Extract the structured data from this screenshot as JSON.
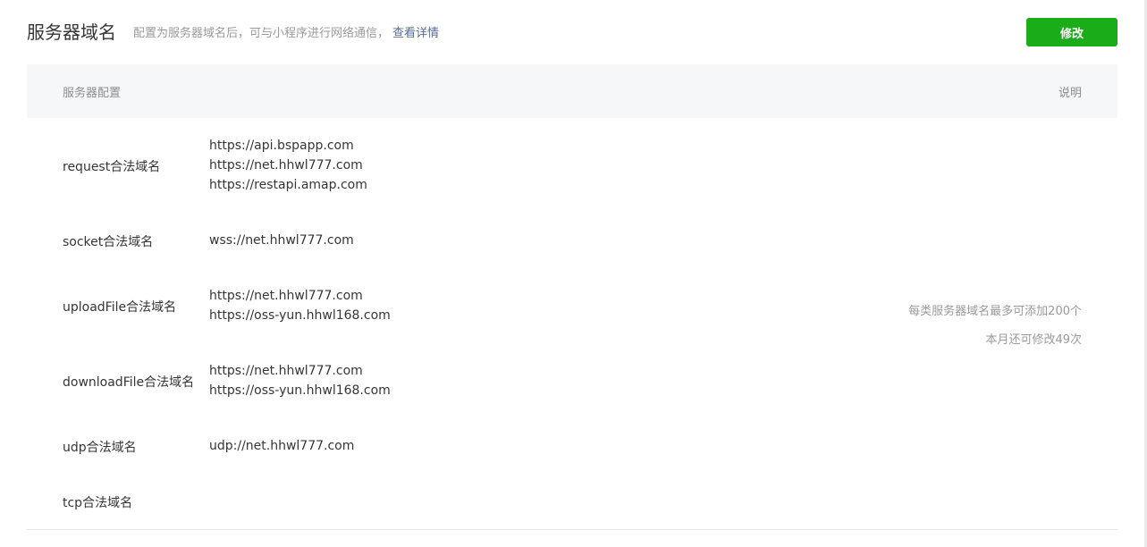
{
  "header": {
    "title": "服务器域名",
    "description": "配置为服务器域名后，可与小程序进行网络通信，",
    "detail_link": "查看详情",
    "edit_button": "修改"
  },
  "table": {
    "col_config": "服务器配置",
    "col_desc": "说明",
    "rows": [
      {
        "label": "request合法域名",
        "values": [
          "https://api.bspapp.com",
          "https://net.hhwl777.com",
          "https://restapi.amap.com"
        ]
      },
      {
        "label": "socket合法域名",
        "values": [
          "wss://net.hhwl777.com"
        ]
      },
      {
        "label": "uploadFile合法域名",
        "values": [
          "https://net.hhwl777.com",
          "https://oss-yun.hhwl168.com"
        ]
      },
      {
        "label": "downloadFile合法域名",
        "values": [
          "https://net.hhwl777.com",
          "https://oss-yun.hhwl168.com"
        ]
      },
      {
        "label": "udp合法域名",
        "values": [
          "udp://net.hhwl777.com"
        ]
      },
      {
        "label": "tcp合法域名",
        "values": []
      }
    ],
    "note_line1": "每类服务器域名最多可添加200个",
    "note_line2": "本月还可修改49次"
  }
}
